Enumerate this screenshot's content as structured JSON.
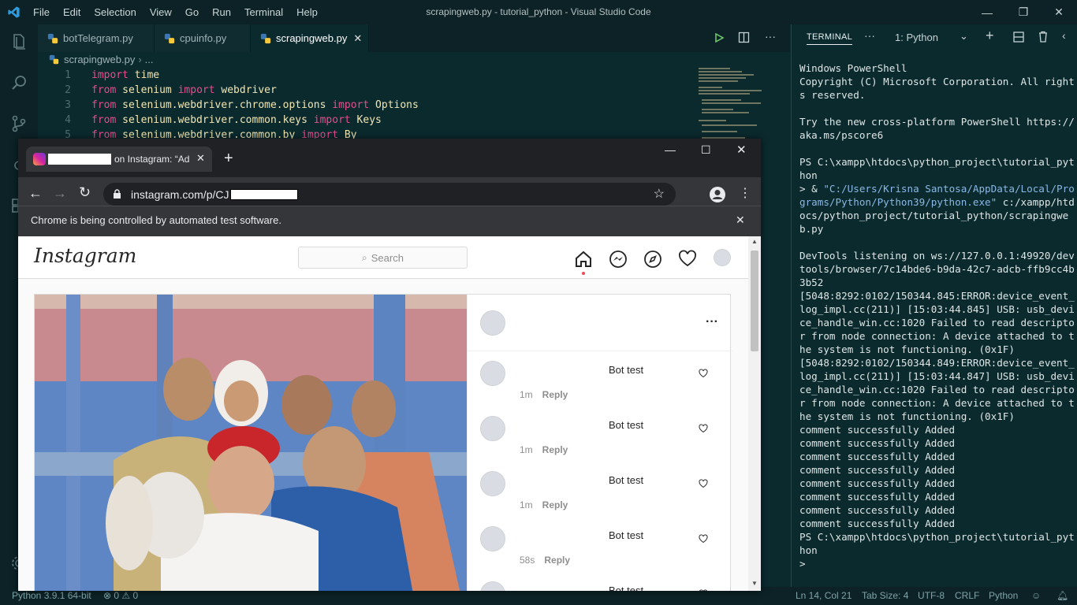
{
  "window": {
    "title": "scrapingweb.py - tutorial_python - Visual Studio Code",
    "menu": [
      "File",
      "Edit",
      "Selection",
      "View",
      "Go",
      "Run",
      "Terminal",
      "Help"
    ]
  },
  "editor": {
    "tabs": [
      {
        "label": "botTelegram.py",
        "active": false
      },
      {
        "label": "cpuinfo.py",
        "active": false
      },
      {
        "label": "scrapingweb.py",
        "active": true
      }
    ],
    "breadcrumb": {
      "file": "scrapingweb.py",
      "rest": "..."
    },
    "lines": [
      {
        "n": "1",
        "tokens": [
          {
            "t": "import",
            "c": "kw"
          },
          {
            "t": " time",
            "c": "id"
          }
        ]
      },
      {
        "n": "2",
        "tokens": [
          {
            "t": "from",
            "c": "kw"
          },
          {
            "t": " selenium ",
            "c": "id"
          },
          {
            "t": "import",
            "c": "kw"
          },
          {
            "t": " webdriver",
            "c": "id"
          }
        ]
      },
      {
        "n": "3",
        "tokens": [
          {
            "t": "from",
            "c": "kw"
          },
          {
            "t": " selenium.webdriver.chrome.options ",
            "c": "id"
          },
          {
            "t": "import",
            "c": "kw"
          },
          {
            "t": " Options",
            "c": "id"
          }
        ]
      },
      {
        "n": "4",
        "tokens": [
          {
            "t": "from",
            "c": "kw"
          },
          {
            "t": " selenium.webdriver.common.keys ",
            "c": "id"
          },
          {
            "t": "import",
            "c": "kw"
          },
          {
            "t": " Keys",
            "c": "id"
          }
        ]
      },
      {
        "n": "5",
        "tokens": [
          {
            "t": "from",
            "c": "kw"
          },
          {
            "t": " selenium.webdriver.common.by ",
            "c": "id"
          },
          {
            "t": "import",
            "c": "kw"
          },
          {
            "t": " By",
            "c": "id"
          }
        ]
      }
    ]
  },
  "terminal": {
    "tab_label": "TERMINAL",
    "shell_select": "1: Python",
    "lines": [
      "Windows PowerShell",
      "Copyright (C) Microsoft Corporation. All rights reserved.",
      "",
      "Try the new cross-platform PowerShell https://aka.ms/pscore6",
      "",
      "PS C:\\xampp\\htdocs\\python_project\\tutorial_python",
      "__CMD__",
      "",
      "DevTools listening on ws://127.0.0.1:49920/devtools/browser/7c14bde6-b9da-42c7-adcb-ffb9cc4b3b52",
      "[5048:8292:0102/150344.845:ERROR:device_event_log_impl.cc(211)] [15:03:44.845] USB: usb_device_handle_win.cc:1020 Failed to read descriptor from node connection: A device attached to the system is not functioning. (0x1F)",
      "[5048:8292:0102/150344.849:ERROR:device_event_log_impl.cc(211)] [15:03:44.847] USB: usb_device_handle_win.cc:1020 Failed to read descriptor from node connection: A device attached to the system is not functioning. (0x1F)",
      "comment successfully Added",
      "comment successfully Added",
      "comment successfully Added",
      "comment successfully Added",
      "comment successfully Added",
      "comment successfully Added",
      "comment successfully Added",
      "comment successfully Added",
      "PS C:\\xampp\\htdocs\\python_project\\tutorial_python",
      ">"
    ],
    "command": {
      "prefix": "> & ",
      "path": "\"C:/Users/Krisna Santosa/AppData/Local/Programs/Python/Python39/python.exe\"",
      "arg": " c:/xampp/htdocs/python_project/tutorial_python/scrapingweb.py"
    }
  },
  "status": {
    "python": "Python 3.9.1 64-bit",
    "problems": "⊗ 0 ⚠ 0",
    "position": "Ln 14, Col 21",
    "tabsize": "Tab Size: 4",
    "encoding": "UTF-8",
    "eol": "CRLF",
    "language": "Python"
  },
  "chrome": {
    "tab_title": "on Instagram: “Ad",
    "url": "instagram.com/p/CJ",
    "infobar": "Chrome is being controlled by automated test software."
  },
  "instagram": {
    "logo": "Instagram",
    "search_placeholder": "Search",
    "comments": [
      {
        "text": "Bot test",
        "time": "1m",
        "reply": "Reply"
      },
      {
        "text": "Bot test",
        "time": "1m",
        "reply": "Reply"
      },
      {
        "text": "Bot test",
        "time": "1m",
        "reply": "Reply"
      },
      {
        "text": "Bot test",
        "time": "58s",
        "reply": "Reply"
      },
      {
        "text": "Bot test",
        "time": "",
        "reply": ""
      }
    ]
  },
  "colors": {
    "accent": "#0b2a2e",
    "keyword": "#e74d8c",
    "terminal_string": "#8ab8e6"
  }
}
